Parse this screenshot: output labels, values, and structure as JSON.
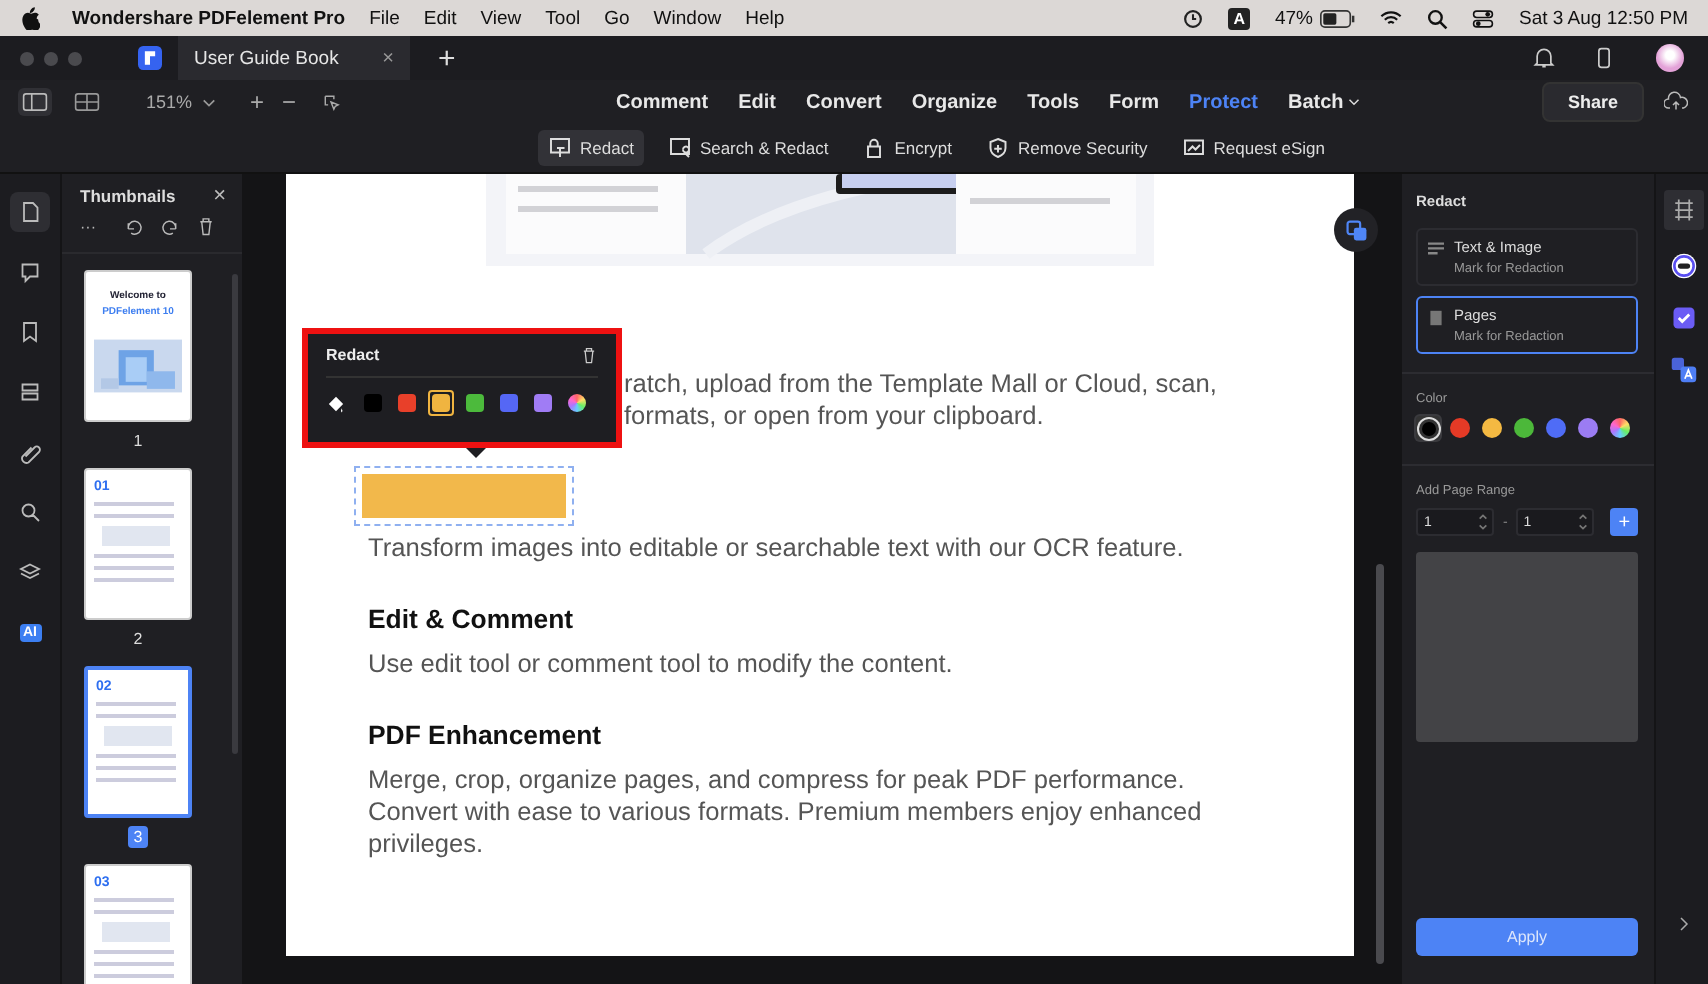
{
  "menubar": {
    "app": "Wondershare PDFelement Pro",
    "menus": [
      "File",
      "Edit",
      "View",
      "Tool",
      "Go",
      "Window",
      "Help"
    ],
    "input_badge": "A",
    "battery": "47%",
    "datetime": "Sat 3 Aug  12:50 PM"
  },
  "tab": {
    "title": "User Guide Book",
    "close": "×",
    "new": "+"
  },
  "toolbar": {
    "zoom": "151%",
    "zoom_in": "+",
    "zoom_out": "−",
    "share": "Share",
    "menus": [
      {
        "label": "Comment",
        "selected": false,
        "dropdown": false
      },
      {
        "label": "Edit",
        "selected": false,
        "dropdown": false
      },
      {
        "label": "Convert",
        "selected": false,
        "dropdown": false
      },
      {
        "label": "Organize",
        "selected": false,
        "dropdown": false
      },
      {
        "label": "Tools",
        "selected": false,
        "dropdown": false
      },
      {
        "label": "Form",
        "selected": false,
        "dropdown": false
      },
      {
        "label": "Protect",
        "selected": true,
        "dropdown": false
      },
      {
        "label": "Batch",
        "selected": false,
        "dropdown": true
      }
    ]
  },
  "protect_tools": [
    {
      "label": "Redact",
      "kind": "redact",
      "selected": true
    },
    {
      "label": "Search & Redact",
      "kind": "search",
      "selected": false
    },
    {
      "label": "Encrypt",
      "kind": "lock",
      "selected": false
    },
    {
      "label": "Remove Security",
      "kind": "shield",
      "selected": false
    },
    {
      "label": "Request eSign",
      "kind": "sign",
      "selected": false
    }
  ],
  "sidebar": {
    "items": [
      {
        "kind": "page",
        "selected": true
      },
      {
        "kind": "comment",
        "selected": false
      },
      {
        "kind": "bookmark",
        "selected": false
      },
      {
        "kind": "layers",
        "selected": false
      },
      {
        "kind": "attachment",
        "selected": false
      },
      {
        "kind": "search",
        "selected": false
      },
      {
        "kind": "stack",
        "selected": false
      },
      {
        "kind": "ai",
        "label": "AI",
        "selected": false
      }
    ]
  },
  "thumbnails": {
    "title": "Thumbnails",
    "close": "×",
    "more": "···",
    "pages": [
      {
        "label": "1",
        "heading": "Welcome to",
        "subheading": "PDFelement 10",
        "selected": false
      },
      {
        "label": "2",
        "heading": "01",
        "selected": false
      },
      {
        "label": "3",
        "heading": "02",
        "selected": true
      },
      {
        "heading": "03",
        "selected": false
      }
    ]
  },
  "document": {
    "covered_lines": [
      "ratch, upload from the Template Mall or Cloud, scan,",
      "formats, or open from your clipboard."
    ],
    "ocr_text": "Transform images into editable or searchable text with our OCR feature.",
    "sections": [
      {
        "heading": "Edit & Comment",
        "text": "Use edit tool or comment tool to modify the content."
      },
      {
        "heading": "PDF Enhancement",
        "text": "Merge, crop, organize pages, and compress for peak PDF performance. Convert with ease to various formats. Premium members enjoy enhanced privileges."
      }
    ]
  },
  "redact_popup": {
    "title": "Redact",
    "colors": [
      {
        "kind": "solid",
        "color": "#000000",
        "selected": false
      },
      {
        "kind": "solid",
        "color": "#e8402a",
        "selected": false
      },
      {
        "kind": "solid",
        "color": "#f0b440",
        "selected": true
      },
      {
        "kind": "solid",
        "color": "#4cba3c",
        "selected": false
      },
      {
        "kind": "solid",
        "color": "#5567f5",
        "selected": false
      },
      {
        "kind": "solid",
        "color": "#a07cf5",
        "selected": false
      },
      {
        "kind": "custom",
        "selected": false
      }
    ]
  },
  "right_panel": {
    "title": "Redact",
    "options": [
      {
        "kind": "text",
        "title": "Text & Image",
        "subtitle": "Mark for Redaction",
        "selected": false
      },
      {
        "kind": "pages",
        "title": "Pages",
        "subtitle": "Mark for Redaction",
        "selected": true
      }
    ],
    "color_label": "Color",
    "colors": [
      {
        "kind": "solid",
        "color": "#000000",
        "selected": true
      },
      {
        "kind": "solid",
        "color": "#e53a26",
        "selected": false
      },
      {
        "kind": "solid",
        "color": "#f4b942",
        "selected": false
      },
      {
        "kind": "solid",
        "color": "#4cb83a",
        "selected": false
      },
      {
        "kind": "solid",
        "color": "#4f6cf6",
        "selected": false
      },
      {
        "kind": "solid",
        "color": "#9b7cf3",
        "selected": false
      },
      {
        "kind": "custom",
        "selected": false
      }
    ],
    "range_label": "Add Page Range",
    "range_from": "1",
    "range_separator": "-",
    "range_to": "1",
    "add": "+",
    "apply": "Apply"
  }
}
